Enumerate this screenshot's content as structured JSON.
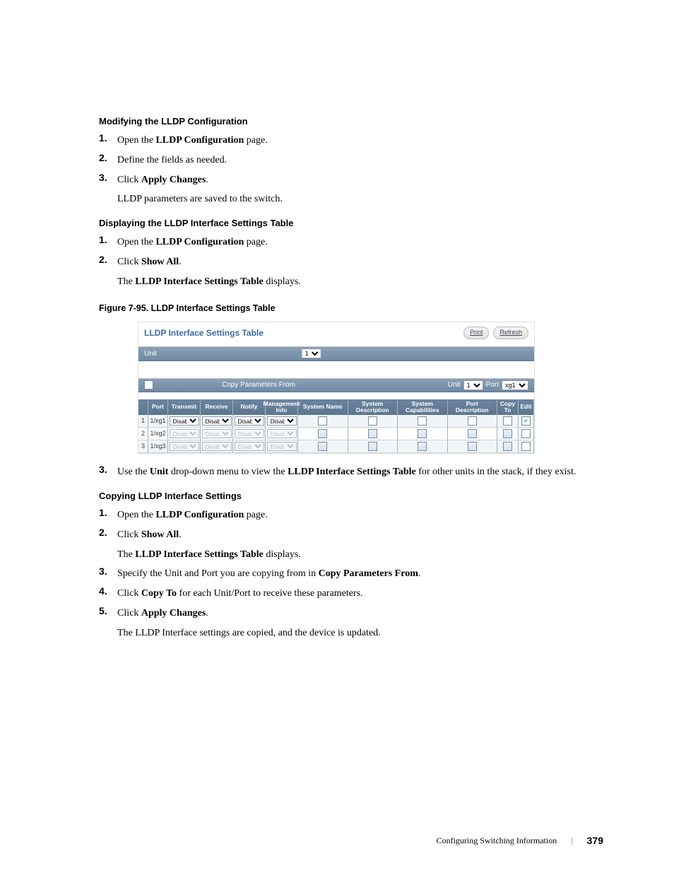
{
  "sections": {
    "s1": {
      "heading": "Modifying the LLDP Configuration",
      "steps": [
        {
          "n": "1.",
          "pre": "Open the ",
          "b": "LLDP Configuration",
          "post": " page."
        },
        {
          "n": "2.",
          "pre": "Define the fields as needed.",
          "b": "",
          "post": ""
        },
        {
          "n": "3.",
          "pre": "Click ",
          "b": "Apply Changes",
          "post": ".",
          "sub": "LLDP parameters are saved to the switch."
        }
      ]
    },
    "s2": {
      "heading": "Displaying the LLDP Interface Settings Table",
      "steps": [
        {
          "n": "1.",
          "pre": "Open the ",
          "b": "LLDP Configuration",
          "post": " page."
        },
        {
          "n": "2.",
          "pre": "Click ",
          "b": "Show All",
          "post": ".",
          "subPre": "The ",
          "subB": "LLDP Interface Settings Table",
          "subPost": " displays."
        }
      ]
    },
    "figCaption": "Figure 7-95.    LLDP Interface Settings Table",
    "screenshot": {
      "title": "LLDP Interface Settings Table",
      "printBtn": "Print",
      "refreshBtn": "Refresh",
      "unitLabel": "Unit",
      "unitValue": "1",
      "copyLabel": "Copy Parameters From",
      "copyUnitLabel": "Unit",
      "copyUnitValue": "1",
      "copyPortLabel": "Port",
      "copyPortValue": "xg1",
      "headers": {
        "port": "Port",
        "transmit": "Transmit",
        "receive": "Receive",
        "notify": "Notify",
        "mgmt": "Management Info",
        "sysName": "System Name",
        "sysDesc": "System Description",
        "sysCap": "System Capabilities",
        "portDesc": "Port Description",
        "copyTo": "Copy To",
        "edit": "Edit"
      },
      "rows": [
        {
          "idx": "1",
          "port": "1/xg1",
          "t": "Disable",
          "r": "Disable",
          "n": "Disable",
          "m": "Disable",
          "enabled": true,
          "edit": true
        },
        {
          "idx": "2",
          "port": "1/xg2",
          "t": "Disable",
          "r": "Disable",
          "n": "Disable",
          "m": "Disable",
          "enabled": false,
          "edit": false
        },
        {
          "idx": "3",
          "port": "1/xg3",
          "t": "Disable",
          "r": "Disable",
          "n": "Enable",
          "m": "Enable",
          "enabled": false,
          "edit": false
        }
      ]
    },
    "s3step": {
      "n": "3.",
      "pre": "Use the ",
      "b1": "Unit",
      "mid": " drop-down menu to view the ",
      "b2": "LLDP Interface Settings Table",
      "post": " for other units in the stack, if they exist."
    },
    "s4": {
      "heading": "Copying LLDP Interface Settings",
      "steps": [
        {
          "n": "1.",
          "pre": "Open the ",
          "b": "LLDP Configuration",
          "post": " page."
        },
        {
          "n": "2.",
          "pre": "Click ",
          "b": "Show All",
          "post": ".",
          "subPre": "The ",
          "subB": "LLDP Interface Settings Table",
          "subPost": " displays."
        },
        {
          "n": "3.",
          "pre": "Specify the Unit and Port you are copying from in ",
          "b": "Copy Parameters From",
          "post": "."
        },
        {
          "n": "4.",
          "pre": "Click ",
          "b": "Copy To",
          "post": " for each Unit/Port to receive these parameters."
        },
        {
          "n": "5.",
          "pre": "Click ",
          "b": "Apply Changes",
          "post": ".",
          "sub": "The LLDP Interface settings are copied, and the device is updated."
        }
      ]
    }
  },
  "footer": {
    "section": "Configuring Switching Information",
    "page": "379"
  }
}
